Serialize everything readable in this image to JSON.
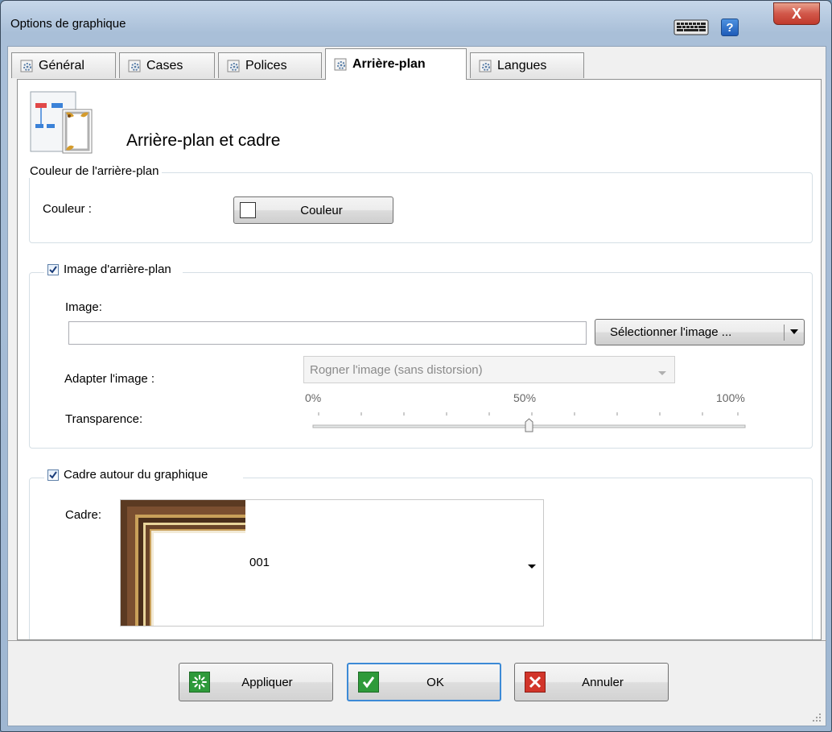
{
  "window": {
    "title": "Options de graphique",
    "help_label": "?",
    "close_label": "X"
  },
  "tabs": [
    {
      "label": "Général"
    },
    {
      "label": "Cases"
    },
    {
      "label": "Polices"
    },
    {
      "label": "Arrière-plan",
      "active": true
    },
    {
      "label": "Langues"
    }
  ],
  "page": {
    "title": "Arrière-plan et cadre",
    "background_color": {
      "group_title": "Couleur de l'arrière-plan",
      "color_label": "Couleur :",
      "color_button_label": "Couleur"
    },
    "background_image": {
      "group_title": "Image d'arrière-plan",
      "checked": true,
      "image_label": "Image:",
      "image_value": "",
      "select_button_label": "Sélectionner l'image ...",
      "fit_label": "Adapter l'image :",
      "fit_value": "Rogner l'image (sans distorsion)",
      "transparency_label": "Transparence:",
      "transparency_ticks": {
        "min": "0%",
        "mid": "50%",
        "max": "100%"
      },
      "transparency_value": 0.5
    },
    "frame": {
      "group_title": "Cadre autour du graphique",
      "checked": true,
      "frame_label": "Cadre:",
      "frame_value": "001"
    }
  },
  "footer": {
    "apply_label": "Appliquer",
    "ok_label": "OK",
    "cancel_label": "Annuler"
  }
}
